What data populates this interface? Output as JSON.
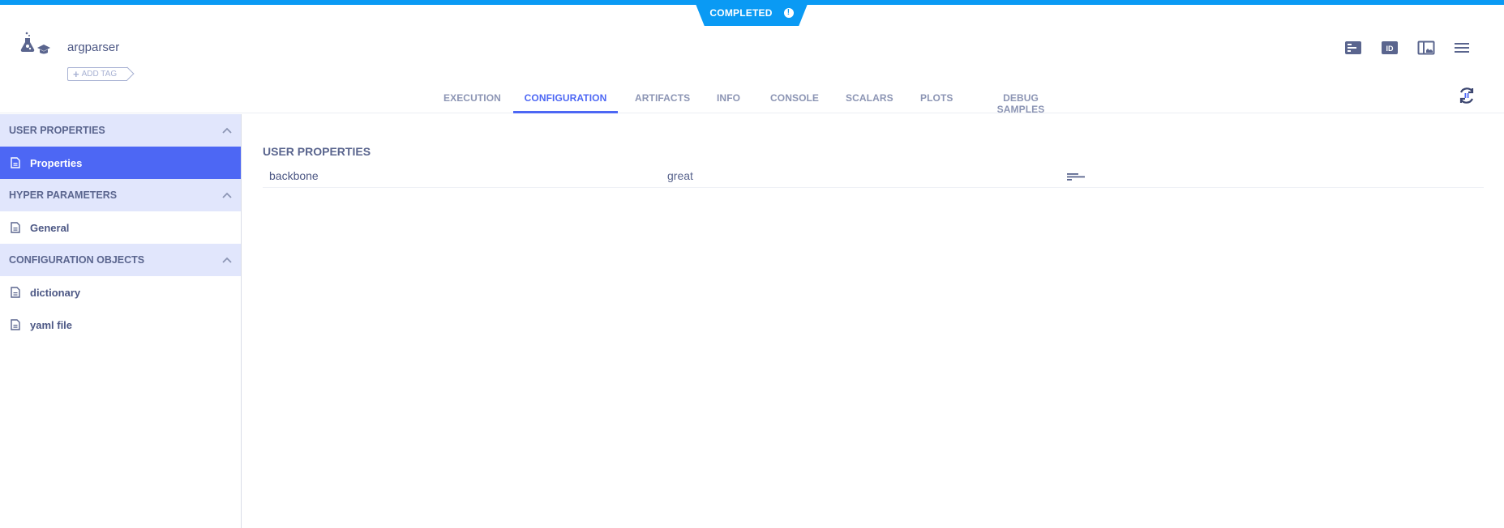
{
  "status": {
    "label": "COMPLETED",
    "icon": "info-icon",
    "color": "#0a9af4"
  },
  "task": {
    "name": "argparser",
    "icon": "experiment-training-icon",
    "add_tag_label": "ADD TAG"
  },
  "header_actions": [
    {
      "name": "details-panel-icon"
    },
    {
      "name": "id-icon"
    },
    {
      "name": "layout-panel-icon"
    },
    {
      "name": "menu-icon"
    }
  ],
  "refresh": {
    "icon": "auto-refresh-paused-icon"
  },
  "tabs": [
    {
      "label": "EXECUTION",
      "active": false
    },
    {
      "label": "CONFIGURATION",
      "active": true
    },
    {
      "label": "ARTIFACTS",
      "active": false
    },
    {
      "label": "INFO",
      "active": false
    },
    {
      "label": "CONSOLE",
      "active": false
    },
    {
      "label": "SCALARS",
      "active": false
    },
    {
      "label": "PLOTS",
      "active": false
    },
    {
      "label": "DEBUG SAMPLES",
      "active": false
    }
  ],
  "sidebar": {
    "sections": [
      {
        "title": "USER PROPERTIES",
        "items": [
          {
            "label": "Properties",
            "active": true
          }
        ]
      },
      {
        "title": "HYPER PARAMETERS",
        "items": [
          {
            "label": "General",
            "active": false
          }
        ]
      },
      {
        "title": "CONFIGURATION OBJECTS",
        "items": [
          {
            "label": "dictionary",
            "active": false
          },
          {
            "label": "yaml file",
            "active": false
          }
        ]
      }
    ]
  },
  "main": {
    "title": "USER PROPERTIES",
    "rows": [
      {
        "key": "backbone",
        "value": "great",
        "action_icon": "description-icon"
      }
    ]
  },
  "colors": {
    "accent": "#4d67f4",
    "section_bg": "#e1e6fc",
    "text": "#5a658e"
  }
}
